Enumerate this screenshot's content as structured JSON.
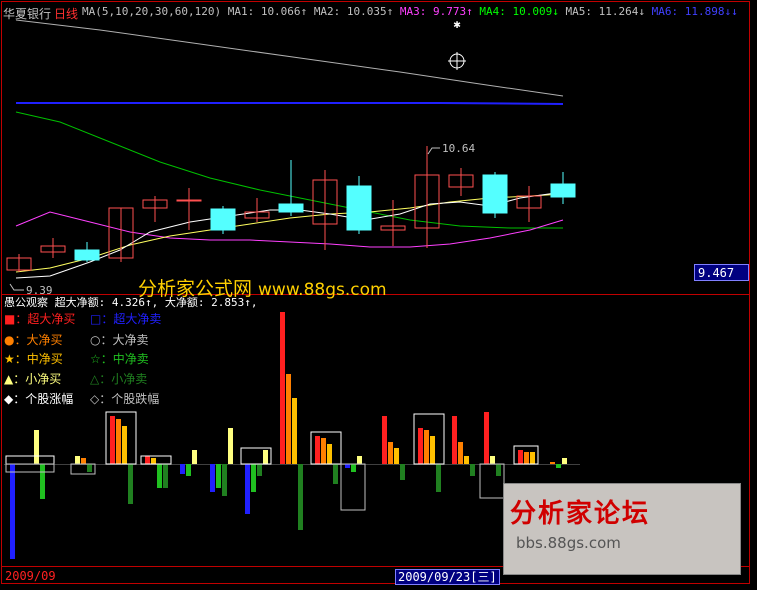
{
  "header": {
    "stock_name": "华夏银行",
    "period": "日线",
    "ma_items": [
      {
        "text": "MA(5,10,20,30,60,120)",
        "color": "#c0c0c0"
      },
      {
        "text": "MA1: 10.066↑",
        "color": "#c0c0c0"
      },
      {
        "text": "MA2: 10.035↑",
        "color": "#c0c0c0"
      },
      {
        "text": "MA3: 9.773↑",
        "color": "#ff40ff"
      },
      {
        "text": "MA4: 10.009↓",
        "color": "#00ff00"
      },
      {
        "text": "MA5: 11.264↓",
        "color": "#c0c0c0"
      },
      {
        "text": "MA6: 11.898↓↓",
        "color": "#4040ff"
      }
    ]
  },
  "price_labels": {
    "high": "10.64",
    "low": "9.39",
    "current": "9.467"
  },
  "watermark": {
    "text": "分析家公式网",
    "url": "www.88gs.com"
  },
  "indicator": {
    "title": "愚公观察",
    "values": [
      {
        "text": "超大净额: 4.326↑,",
        "color": "#ffffff"
      },
      {
        "text": "大净额: 2.853↑,",
        "color": "#ffffff"
      }
    ],
    "legend": [
      {
        "symbol": "■",
        "symbol_color": "#ff2020",
        "label": "：超大净买",
        "color": "#ff2020"
      },
      {
        "symbol": "□",
        "symbol_color": "#2020ff",
        "label": "：超大净卖",
        "color": "#2020ff"
      },
      {
        "symbol": "●",
        "symbol_color": "#ff8000",
        "label": "：大净买",
        "color": "#ff8000"
      },
      {
        "symbol": "○",
        "symbol_color": "#c0c0c0",
        "label": "：大净卖",
        "color": "#c0c0c0"
      },
      {
        "symbol": "★",
        "symbol_color": "#ffc000",
        "label": "：中净买",
        "color": "#ffc000"
      },
      {
        "symbol": "☆",
        "symbol_color": "#20c020",
        "label": "：中净卖",
        "color": "#20c020"
      },
      {
        "symbol": "▲",
        "symbol_color": "#ffff80",
        "label": "：小净买",
        "color": "#ffff80"
      },
      {
        "symbol": "△",
        "symbol_color": "#208020",
        "label": "：小净卖",
        "color": "#208020"
      },
      {
        "symbol": "◆",
        "symbol_color": "#ffffff",
        "label": "：个股涨幅",
        "color": "#ffffff"
      },
      {
        "symbol": "◇",
        "symbol_color": "#c0c0c0",
        "label": "：个股跌幅",
        "color": "#c0c0c0"
      }
    ]
  },
  "footer": {
    "left_date": "2009/09",
    "cursor_date": "2009/09/23[三]"
  },
  "forum": {
    "title": "分析家论坛",
    "url": "bbs.88gs.com"
  },
  "colors": {
    "up_candle": "#ff5050",
    "down_candle": "#54ffff",
    "ma_white": "#ffffff",
    "ma_yellow": "#ffff60",
    "ma_magenta": "#ff40ff",
    "ma_green": "#00c000",
    "ma_gray": "#b0b0b0",
    "ma_blue": "#2020ff",
    "frame": "#c00000",
    "date_color": "#ff2020"
  }
}
